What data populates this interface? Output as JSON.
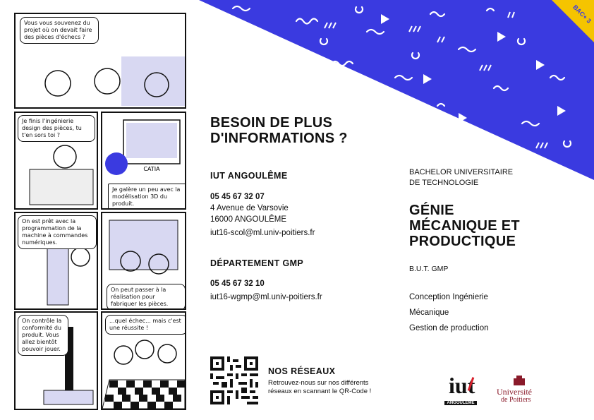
{
  "colors": {
    "accent": "#3a3ae0",
    "badge": "#f5c400",
    "ink": "#111111"
  },
  "comic": {
    "bubbles": [
      "Vous vous souvenez du projet où on devait faire des pièces d'échecs ?",
      "Je finis l'ingénierie design des pièces, tu t'en sors toi ?",
      "Je galère un peu avec la modélisation 3D du produit.",
      "On est prêt avec la programmation de la machine à commandes numériques.",
      "On peut passer à la réalisation pour fabriquer les pièces.",
      "On contrôle la conformité du produit. Vous allez bientôt pouvoir jouer.",
      "...quel échec... mais c'est une réussite !"
    ],
    "screen_label": "CATIA"
  },
  "badge": "BAC+ 3",
  "info": {
    "heading_line1": "BESOIN DE PLUS",
    "heading_line2": "D'INFORMATIONS ?",
    "iut": {
      "title": "IUT ANGOULÊME",
      "phone": "05 45 67 32 07",
      "address1": "4 Avenue de Varsovie",
      "address2": "16000 ANGOULÊME",
      "email": "iut16-scol@ml.univ-poitiers.fr"
    },
    "dept": {
      "title": "DÉPARTEMENT GMP",
      "phone": "05 45 67 32 10",
      "email": "iut16-wgmp@ml.univ-poitiers.fr"
    },
    "social": {
      "title": "NOS RÉSEAUX",
      "line1": "Retrouvez-nous sur nos différents",
      "line2": "réseaux en scannant le QR-Code !"
    }
  },
  "program": {
    "kicker1": "BACHELOR UNIVERSITAIRE",
    "kicker2": "DE TECHNOLOGIE",
    "title1": "GÉNIE",
    "title2": "MÉCANIQUE ET",
    "title3": "PRODUCTIQUE",
    "short": "B.U.T. GMP",
    "tracks": [
      "Conception Ingénierie",
      "Mécanique",
      "Gestion de production"
    ]
  },
  "logos": {
    "iut_text": "iut",
    "iut_sub": "ANGOULÊME",
    "up_line1": "Université",
    "up_line2": "de Poitiers"
  }
}
